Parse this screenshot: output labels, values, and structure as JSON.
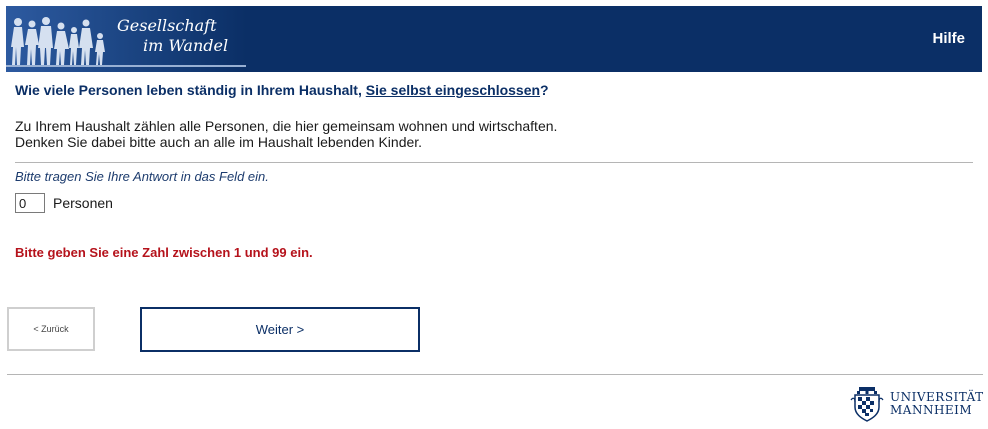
{
  "header": {
    "logo_line1": "Gesellschaft",
    "logo_line2": "im Wandel",
    "help_label": "Hilfe",
    "color": "#0b2f66"
  },
  "question": {
    "text_before": "Wie viele Personen leben ständig in Ihrem Haushalt, ",
    "underlined": "Sie selbst eingeschlossen",
    "text_after": "?"
  },
  "instructions": {
    "line1": "Zu Ihrem Haushalt zählen alle Personen, die hier gemeinsam wohnen und wirtschaften.",
    "line2": "Denken Sie dabei bitte auch an alle im Haushalt lebenden Kinder."
  },
  "hint": "Bitte tragen Sie Ihre Antwort in das Feld ein.",
  "answer": {
    "value": "0",
    "unit": "Personen"
  },
  "error": {
    "text": "Bitte geben Sie eine Zahl zwischen 1 und 99 ein.",
    "color": "#b5121b"
  },
  "nav": {
    "back_label": "< Zurück",
    "next_label": "Weiter >"
  },
  "footer": {
    "uni_line1": "UNIVERSITÄT",
    "uni_line2": "MANNHEIM",
    "uni_icon": "university-seal-icon"
  }
}
